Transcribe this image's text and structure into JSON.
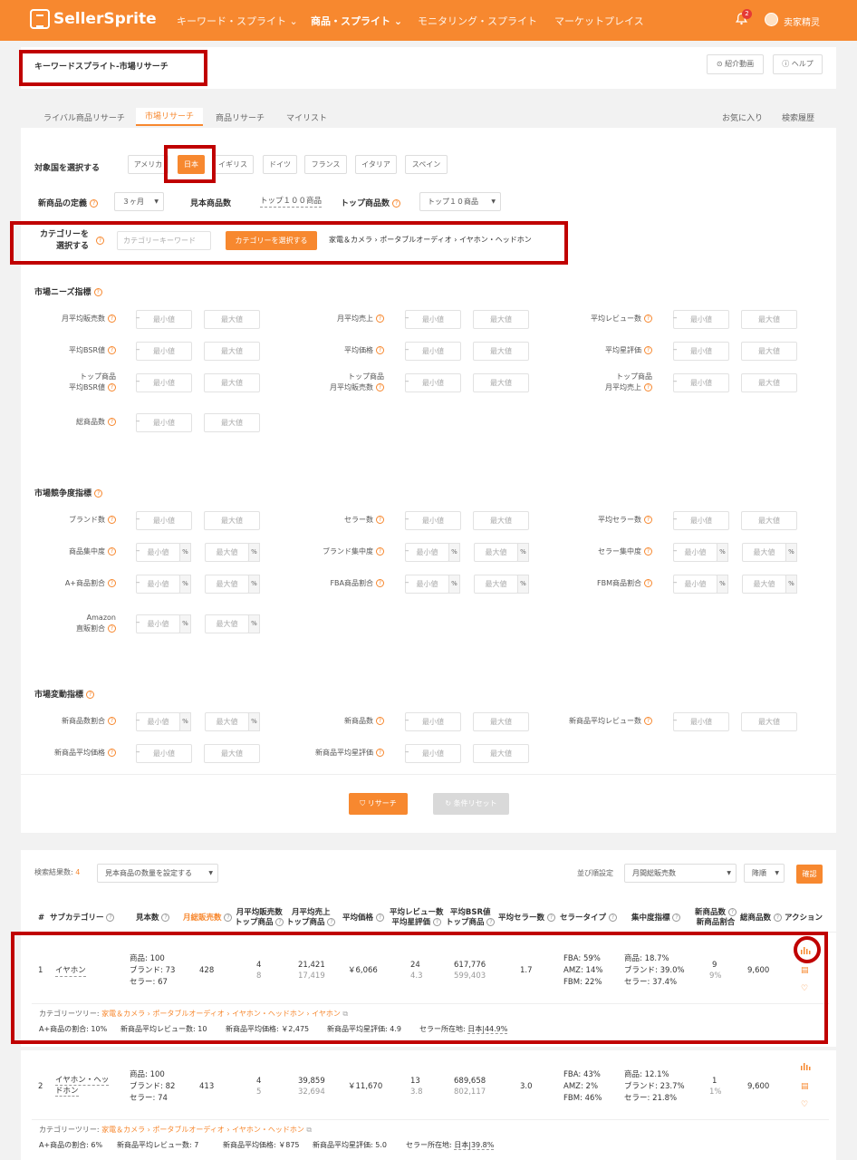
{
  "nav": {
    "logo": "SellerSprite",
    "items": [
      "キーワード・スプライト",
      "商品・スプライト",
      "モニタリング・スプライト",
      "マーケットプレイス"
    ],
    "notification_count": "2",
    "username": "卖家精灵"
  },
  "header": {
    "title": "キーワードスプライト-市場リサーチ",
    "video_button": "紹介動画",
    "help_button": "ヘルプ"
  },
  "tabs": {
    "items": [
      "ライバル商品リサーチ",
      "市場リサーチ",
      "商品リサーチ",
      "マイリスト"
    ],
    "favorites": "お気に入り",
    "history": "検索履歴"
  },
  "filters": {
    "country_label": "対象国を選択する",
    "countries": [
      "アメリカ",
      "日本",
      "イギリス",
      "ドイツ",
      "フランス",
      "イタリア",
      "スペイン"
    ],
    "selected_country": "日本",
    "new_product_label": "新商品の定義",
    "new_product_value": "３ヶ月",
    "sample_label": "見本商品数",
    "sample_value": "トップ１００商品",
    "top_label": "トップ商品数",
    "top_value": "トップ１０商品",
    "category_label_1": "カテゴリーを",
    "category_label_2": "選択する",
    "category_placeholder": "カテゴリーキーワード",
    "category_button": "カテゴリーを選択する",
    "category_path": "家電＆カメラ › ポータブルオーディオ › イヤホン・ヘッドホン",
    "min_placeholder": "最小値",
    "max_placeholder": "最大値",
    "pct": "%"
  },
  "demand": {
    "title": "市場ニーズ指標",
    "fields": [
      [
        "月平均販売数"
      ],
      [
        "月平均売上"
      ],
      [
        "平均レビュー数"
      ],
      [
        "平均BSR値"
      ],
      [
        "平均価格"
      ],
      [
        "平均星評価"
      ],
      [
        "トップ商品",
        "平均BSR値"
      ],
      [
        "トップ商品",
        "月平均販売数"
      ],
      [
        "トップ商品",
        "月平均売上"
      ],
      [
        "総商品数"
      ]
    ]
  },
  "competition": {
    "title": "市場競争度指標",
    "fields": [
      [
        "ブランド数"
      ],
      [
        "セラー数"
      ],
      [
        "平均セラー数"
      ],
      [
        "商品集中度"
      ],
      [
        "ブランド集中度"
      ],
      [
        "セラー集中度"
      ],
      [
        "A+商品割合"
      ],
      [
        "FBA商品割合"
      ],
      [
        "FBM商品割合"
      ],
      [
        "Amazon",
        "直販割合"
      ]
    ]
  },
  "change": {
    "title": "市場変動指標",
    "fields": [
      [
        "新商品数割合"
      ],
      [
        "新商品数"
      ],
      [
        "新商品平均レビュー数"
      ],
      [
        "新商品平均価格"
      ],
      [
        "新商品平均星評価"
      ]
    ]
  },
  "actions": {
    "search": "リサーチ",
    "reset": "条件リセット"
  },
  "results": {
    "count_label": "検索結果数:",
    "count": "4",
    "sample_select": "見本商品の数量を設定する",
    "sort_label": "並び順設定",
    "sort_value": "月間総販売数",
    "order_value": "降順",
    "confirm": "確認",
    "headers": {
      "num": "#",
      "subcat": "サブカテゴリー",
      "sample": "見本数",
      "monthly_sales": "月総販売数",
      "avg_sales_1": "月平均販売数",
      "avg_sales_2": "トップ商品",
      "avg_rev_1": "月平均売上",
      "avg_rev_2": "トップ商品",
      "avg_price": "平均価格",
      "review_1": "平均レビュー数",
      "review_2": "平均星評価",
      "bsr_1": "平均BSR値",
      "bsr_2": "トップ商品",
      "sellers": "平均セラー数",
      "seller_type": "セラータイプ",
      "concentration": "集中度指標",
      "new_1": "新商品数",
      "new_2": "新商品割合",
      "total": "総商品数",
      "action": "アクション"
    },
    "rows": [
      {
        "num": "1",
        "name": "イヤホン",
        "sample_1": "商品: 100",
        "sample_2": "ブランド: 73",
        "sample_3": "セラー: 67",
        "monthly": "428",
        "avg_sales": "4",
        "avg_sales_top": "8",
        "avg_rev": "21,421",
        "avg_rev_top": "17,419",
        "price": "￥6,066",
        "reviews": "24",
        "stars": "4.3",
        "bsr": "617,776",
        "bsr_top": "599,403",
        "sellers": "1.7",
        "fba": "FBA: 59%",
        "amz": "AMZ: 14%",
        "fbm": "FBM: 22%",
        "c1": "商品: 18.7%",
        "c2": "ブランド: 39.0%",
        "c3": "セラー: 37.4%",
        "new": "9",
        "new_pct": "9%",
        "total": "9,600",
        "tree_label": "カテゴリーツリー:",
        "tree": "家電＆カメラ › ポータブルオーディオ › イヤホン・ヘッドホン › イヤホン",
        "aplus": "A+商品の割合: 10%",
        "new_reviews": "新商品平均レビュー数: 10",
        "new_price": "新商品平均価格: ￥2,475",
        "new_stars": "新商品平均星評価: 4.9",
        "seller_loc_label": "セラー所在地:",
        "seller_loc": "日本|44.9%"
      },
      {
        "num": "2",
        "name": "イヤホン・ヘッドホン",
        "sample_1": "商品: 100",
        "sample_2": "ブランド: 82",
        "sample_3": "セラー: 74",
        "monthly": "413",
        "avg_sales": "4",
        "avg_sales_top": "5",
        "avg_rev": "39,859",
        "avg_rev_top": "32,694",
        "price": "￥11,670",
        "reviews": "13",
        "stars": "3.8",
        "bsr": "689,658",
        "bsr_top": "802,117",
        "sellers": "3.0",
        "fba": "FBA: 43%",
        "amz": "AMZ: 2%",
        "fbm": "FBM: 46%",
        "c1": "商品: 12.1%",
        "c2": "ブランド: 23.7%",
        "c3": "セラー: 21.8%",
        "new": "1",
        "new_pct": "1%",
        "total": "9,600",
        "tree_label": "カテゴリーツリー:",
        "tree": "家電＆カメラ › ポータブルオーディオ › イヤホン・ヘッドホン",
        "aplus": "A+商品の割合: 6%",
        "new_reviews": "新商品平均レビュー数: 7",
        "new_price": "新商品平均価格: ￥875",
        "new_stars": "新商品平均星評価: 5.0",
        "seller_loc_label": "セラー所在地:",
        "seller_loc": "日本|39.8%"
      }
    ]
  }
}
